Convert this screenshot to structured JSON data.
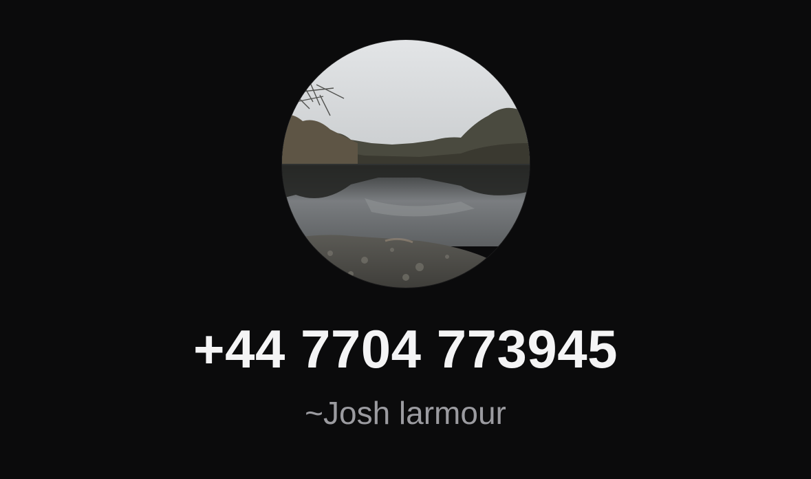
{
  "contact": {
    "phone": "+44 7704 773945",
    "name": "~Josh larmour",
    "avatar_description": "profile-photo"
  },
  "colors": {
    "background": "#0b0b0c",
    "phone_text": "#f4f4f5",
    "name_text": "#9b9ba0"
  }
}
